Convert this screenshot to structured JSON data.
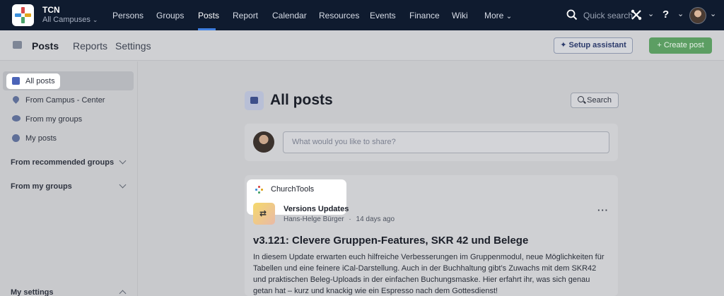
{
  "app": {
    "org_name": "TCN",
    "campus_label": "All Campuses",
    "brand_colors": [
      "#d94a4a",
      "#3a8fdc",
      "#e0a41b",
      "#4aa36b"
    ]
  },
  "topnav": {
    "items": [
      {
        "label": "Persons"
      },
      {
        "label": "Groups"
      },
      {
        "label": "Posts",
        "active": true
      },
      {
        "label": "Report"
      },
      {
        "label": "Calendar"
      },
      {
        "label": "Resources"
      },
      {
        "label": "Events"
      },
      {
        "label": "Finance"
      },
      {
        "label": "Wiki"
      },
      {
        "label": "More"
      }
    ],
    "quick_search": "Quick search",
    "help_label": "?"
  },
  "subheader": {
    "tabs": [
      {
        "label": "Posts",
        "active": true
      },
      {
        "label": "Reports"
      },
      {
        "label": "Settings"
      }
    ],
    "setup_assistant": "Setup assistant",
    "create_post": "Create post"
  },
  "sidebar": {
    "items": [
      {
        "label": "All posts",
        "icon": "posts-icon",
        "active": true
      },
      {
        "label": "From Campus - Center",
        "icon": "location-pin-icon"
      },
      {
        "label": "From my groups",
        "icon": "group-icon"
      },
      {
        "label": "My posts",
        "icon": "user-icon"
      }
    ],
    "groups": [
      {
        "label": "From recommended groups"
      },
      {
        "label": "From my groups"
      }
    ],
    "settings_label": "My settings"
  },
  "main": {
    "title": "All posts",
    "search_label": "Search",
    "share_placeholder": "What would you like to share?",
    "post": {
      "popup_org": "ChurchTools",
      "group": "Versions Updates",
      "author": "Hans-Helge Bürger",
      "separator": "·",
      "time": "14 days ago",
      "more": "···",
      "title": "v3.121: Clevere Gruppen-Features, SKR 42 und Belege",
      "body": "In diesem Update erwarten euch hilfreiche Verbesserungen im Gruppenmodul, neue Möglichkeiten für Tabellen und eine feinere iCal-Darstellung. Auch in der Buchhaltung gibt’s Zuwachs mit dem SKR42 und praktischen Beleg-Uploads in der einfachen Buchungsmaske. Hier erfahrt ihr, was sich genau getan hat – kurz und knackig wie ein Espresso nach dem Gottesdienst!"
    }
  }
}
